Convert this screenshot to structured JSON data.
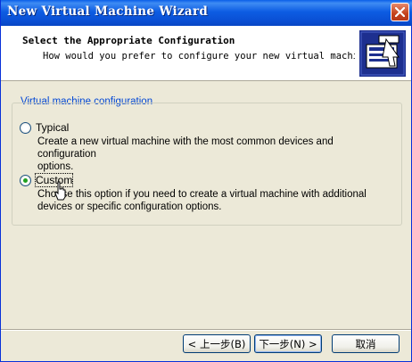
{
  "window": {
    "title": "New Virtual Machine Wizard"
  },
  "header": {
    "title": "Select the Appropriate Configuration",
    "subtitle": "How would you prefer to configure your new virtual machi",
    "icon": "vm-wizard-icon"
  },
  "group": {
    "label": "Virtual machine configuration",
    "options": [
      {
        "label": "Typical",
        "checked": false,
        "description_line1": "Create a new virtual machine with the most common devices and configuration",
        "description_line2": "options."
      },
      {
        "label": "Custom",
        "checked": true,
        "description_line1": "Choose this option if you need to create a virtual machine with additional",
        "description_line2": "devices or specific configuration options."
      }
    ]
  },
  "buttons": {
    "back": "< 上一步(B)",
    "next": "下一步(N) >",
    "cancel": "取消"
  },
  "colors": {
    "titlebar": "#0a5ee8",
    "group_label": "#0046d5",
    "radio_dot": "#21a121",
    "close_button": "#c4421c"
  }
}
